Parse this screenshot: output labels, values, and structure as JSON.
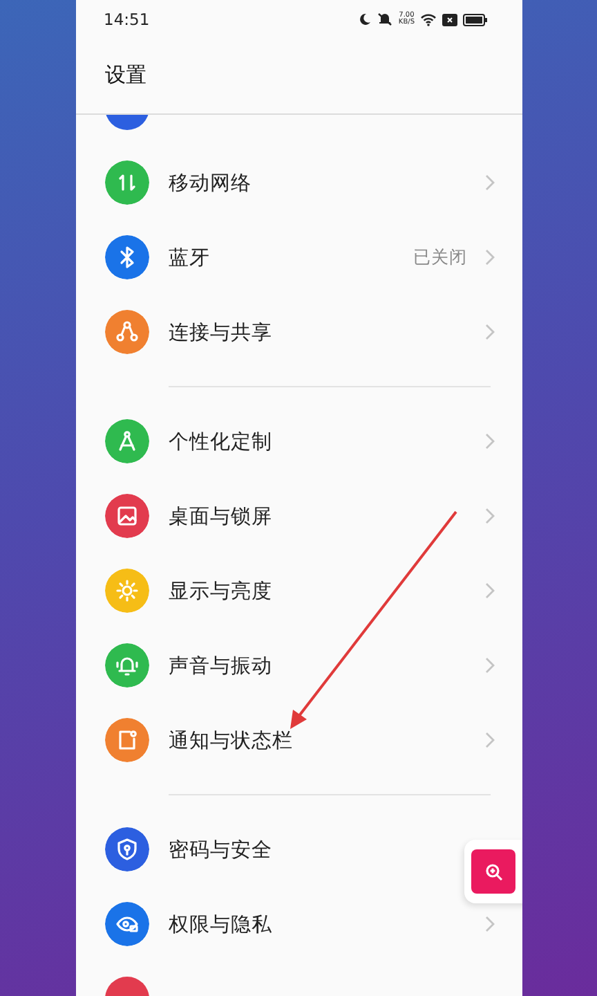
{
  "status_bar": {
    "time": "14:51",
    "speed_value": "7.00",
    "speed_unit": "KB/S"
  },
  "header": {
    "title": "设置"
  },
  "top_stub": {
    "color": "#2c5fe0"
  },
  "groups": [
    {
      "items": [
        {
          "label": "移动网络",
          "chevron": true,
          "color": "#2fba4f"
        },
        {
          "label": "蓝牙",
          "value": "已关闭",
          "chevron": true,
          "color": "#1a73e8"
        },
        {
          "label": "连接与共享",
          "chevron": true,
          "color": "#f08030"
        }
      ]
    },
    {
      "items": [
        {
          "label": "个性化定制",
          "chevron": true,
          "color": "#2fba4f"
        },
        {
          "label": "桌面与锁屏",
          "chevron": true,
          "color": "#e23b4e"
        },
        {
          "label": "显示与亮度",
          "chevron": true,
          "color": "#f6bd16"
        },
        {
          "label": "声音与振动",
          "chevron": true,
          "color": "#2fba4f"
        },
        {
          "label": "通知与状态栏",
          "chevron": true,
          "color": "#f08030"
        }
      ]
    },
    {
      "items": [
        {
          "label": "密码与安全",
          "color": "#2c5fe0"
        },
        {
          "label": "权限与隐私",
          "chevron": true,
          "color": "#1a73e8"
        }
      ]
    }
  ],
  "bottom_stub": {
    "color": "#e23b4e"
  }
}
